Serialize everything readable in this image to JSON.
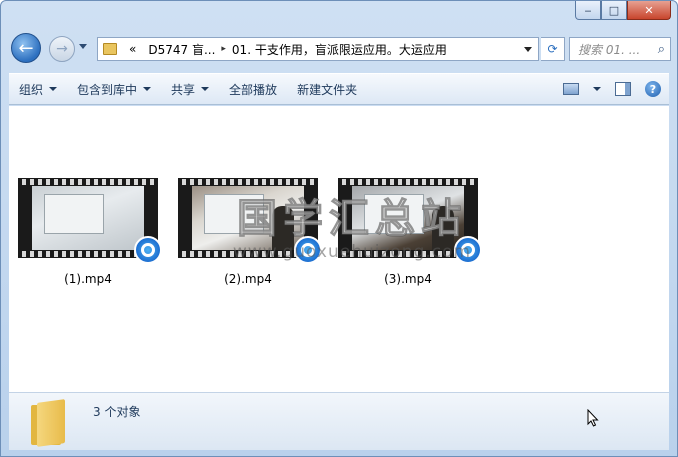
{
  "window": {
    "caption_buttons": {
      "minimize": "‒",
      "maximize": "□",
      "close": "✕"
    }
  },
  "nav": {
    "back_icon": "back-arrow-icon",
    "forward_icon": "forward-arrow-icon",
    "address": {
      "overflow": "«",
      "segments": [
        "D5747 盲...",
        "01. 干支作用，盲派限运应用。大运应用"
      ],
      "separator": "▸"
    },
    "search_placeholder": "搜索 01. ...",
    "refresh_glyph": "⟳",
    "search_glyph": "⌕"
  },
  "toolbar": {
    "organize": "组织",
    "include_library": "包含到库中",
    "share": "共享",
    "play_all": "全部播放",
    "new_folder": "新建文件夹"
  },
  "files": [
    {
      "name": "(1).mp4",
      "type": "video"
    },
    {
      "name": "(2).mp4",
      "type": "video"
    },
    {
      "name": "(3).mp4",
      "type": "video"
    }
  ],
  "watermark": {
    "text": "国学汇总站",
    "url": "www.guoxuehuizong.com"
  },
  "details": {
    "count": "3 个对象"
  },
  "help_glyph": "?"
}
